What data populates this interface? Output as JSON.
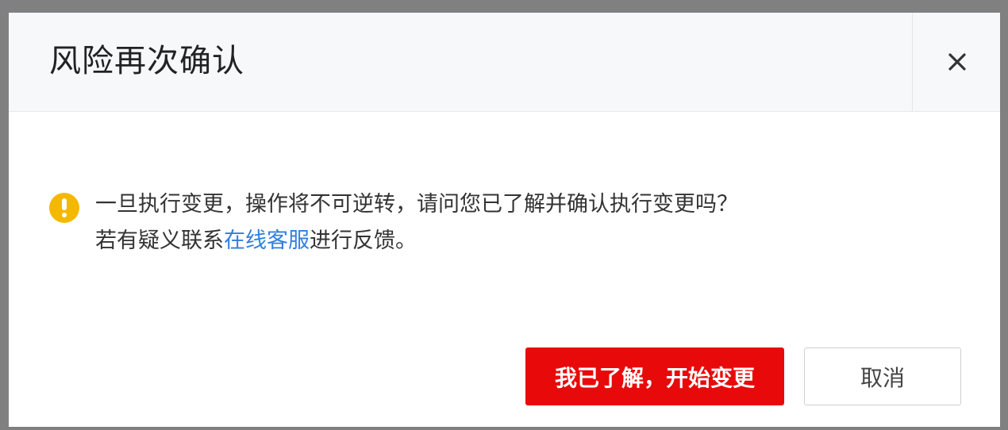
{
  "dialog": {
    "title": "风险再次确认",
    "close_label": "×",
    "message_line1": "一旦执行变更，操作将不可逆转，请问您已了解并确认执行变更吗？",
    "message_line2_prefix": "若有疑义联系",
    "message_link": "在线客服",
    "message_line2_suffix": "进行反馈。",
    "confirm_label": "我已了解，开始变更",
    "cancel_label": "取消",
    "warning_icon": "exclamation-circle-icon",
    "colors": {
      "primary": "#e80a0a",
      "link": "#2f7fe0",
      "warning": "#f5b800"
    }
  }
}
